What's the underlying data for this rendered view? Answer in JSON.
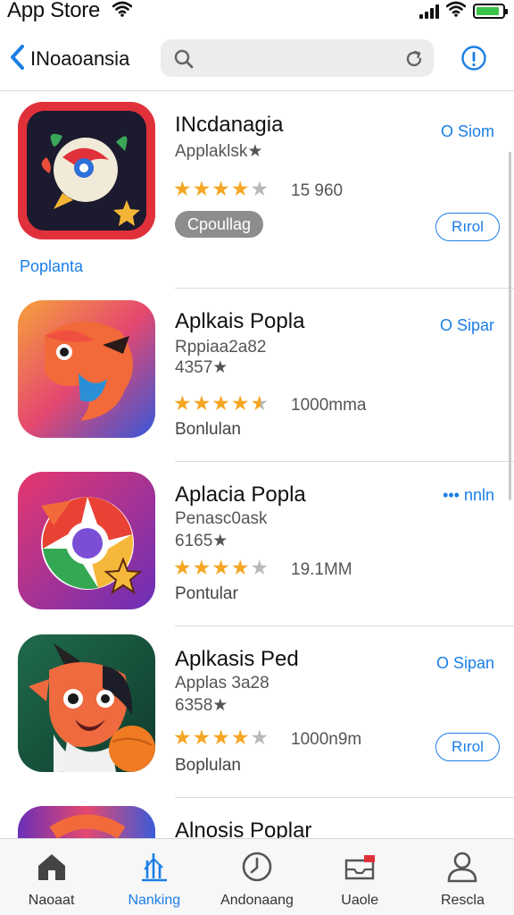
{
  "status": {
    "title": "App Store",
    "battery_level": 0.9,
    "battery_color": "#3bc34a"
  },
  "nav": {
    "back_label": "INoaoansia",
    "search_placeholder": "",
    "icons": {
      "back": "chevron-left-icon",
      "search": "search-icon",
      "reload": "reload-icon",
      "info": "info-icon"
    }
  },
  "apps": [
    {
      "name": "INcdanagia",
      "sub1": "Applaklsk★",
      "sub2": "",
      "rating": 4,
      "rating_count": "15 960",
      "category": "",
      "badge": "Cpoullag",
      "get_label": "O Siom",
      "button_label": "Rırol",
      "section_link": "Poplanta"
    },
    {
      "name": "Aplkais Popla",
      "sub1": "Rppiaa2a82",
      "sub2": "4357★",
      "rating": 4.5,
      "rating_count": "1000mma",
      "category": "Bonlulan",
      "badge": "",
      "get_label": "O Sipar",
      "button_label": "",
      "section_link": ""
    },
    {
      "name": "Aplacia Popla",
      "sub1": "Penasc0ask",
      "sub2": "6165★",
      "rating": 4,
      "rating_count": "19.1MM",
      "category": "Pontular",
      "badge": "",
      "get_label": "••• nnln",
      "button_label": "",
      "section_link": ""
    },
    {
      "name": "Aplkasis Ped",
      "sub1": "Applas 3a28",
      "sub2": "6358★",
      "rating": 4,
      "rating_count": "1000n9m",
      "category": "Boplulan",
      "badge": "",
      "get_label": "O Sipan",
      "button_label": "Rırol",
      "section_link": ""
    },
    {
      "name": "Alnosis Poplar",
      "sub1": "",
      "sub2": "",
      "rating": 0,
      "rating_count": "",
      "category": "",
      "badge": "",
      "get_label": "",
      "button_label": "",
      "section_link": ""
    }
  ],
  "tabs": [
    {
      "label": "Naoaat",
      "icon": "home-icon",
      "active": false
    },
    {
      "label": "Nanking",
      "icon": "chart-icon",
      "active": true
    },
    {
      "label": "Andonaang",
      "icon": "clock-icon",
      "active": false
    },
    {
      "label": "Uaole",
      "icon": "inbox-icon",
      "active": false
    },
    {
      "label": "Rescla",
      "icon": "person-icon",
      "active": false
    }
  ],
  "colors": {
    "accent": "#1a7ee6",
    "star": "#f5a623",
    "star_empty": "#b9b9b9"
  }
}
